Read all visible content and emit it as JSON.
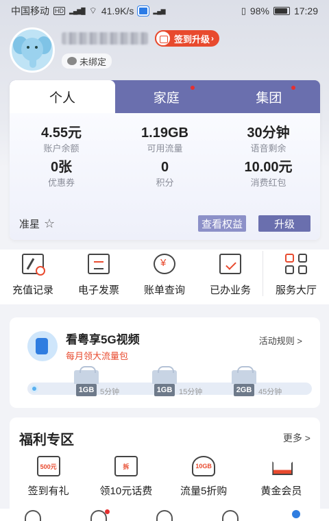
{
  "status_bar": {
    "carrier": "中国移动",
    "hd": "HD",
    "network_speed": "41.9K/s",
    "battery": "98%",
    "time": "17:29"
  },
  "profile": {
    "sign_upgrade_label": "签到升级",
    "bind_status": "未绑定"
  },
  "account_tabs": [
    {
      "label": "个人",
      "active": true,
      "dot": false
    },
    {
      "label": "家庭",
      "active": false,
      "dot": true
    },
    {
      "label": "集团",
      "active": false,
      "dot": true
    }
  ],
  "account_stats": [
    {
      "value": "4.55元",
      "label": "账户余额"
    },
    {
      "value": "1.19GB",
      "label": "可用流量"
    },
    {
      "value": "30分钟",
      "label": "语音剩余"
    },
    {
      "value": "0张",
      "label": "优惠券"
    },
    {
      "value": "0",
      "label": "积分"
    },
    {
      "value": "10.00元",
      "label": "消费红包"
    }
  ],
  "membership": {
    "level": "准星",
    "view_benefits": "查看权益",
    "upgrade": "升级"
  },
  "quick_actions": [
    {
      "label": "充值记录",
      "icon": "recharge-record-icon"
    },
    {
      "label": "电子发票",
      "icon": "invoice-icon"
    },
    {
      "label": "账单查询",
      "icon": "bill-query-icon"
    },
    {
      "label": "已办业务",
      "icon": "handled-business-icon"
    },
    {
      "label": "服务大厅",
      "icon": "service-hall-icon"
    }
  ],
  "promo": {
    "title": "看粤享5G视频",
    "subtitle": "每月领大流量包",
    "rules": "活动规则 >",
    "milestones": [
      {
        "reward": "1GB",
        "minutes": "5分钟"
      },
      {
        "reward": "1GB",
        "minutes": "15分钟"
      },
      {
        "reward": "2GB",
        "minutes": "45分钟"
      }
    ]
  },
  "welfare": {
    "title": "福利专区",
    "more": "更多 >",
    "items": [
      {
        "label": "签到有礼",
        "icon_text": "500元",
        "icon": "calendar-gift-icon"
      },
      {
        "label": "领10元话费",
        "icon_text": "拆",
        "icon": "red-envelope-icon"
      },
      {
        "label": "流量5折购",
        "icon_text": "10GB",
        "icon": "data-bag-icon"
      },
      {
        "label": "黄金会员",
        "icon_text": "",
        "icon": "crown-icon"
      }
    ]
  },
  "colors": {
    "accent": "#6a6fae",
    "brand_red": "#e84a2e",
    "link_blue": "#2f7de0"
  }
}
